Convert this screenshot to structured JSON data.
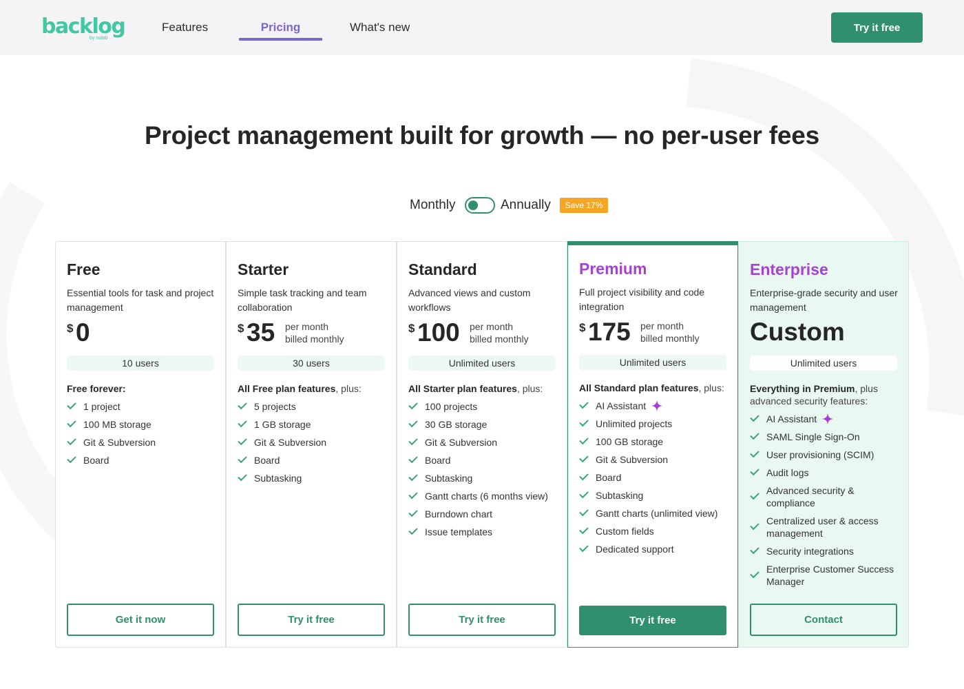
{
  "header": {
    "logo_text": "backlog",
    "logo_sub": "by nulab",
    "nav": [
      {
        "label": "Features"
      },
      {
        "label": "Pricing"
      },
      {
        "label": "What's new"
      }
    ],
    "cta_label": "Try it free"
  },
  "hero": {
    "headline": "Project management built for growth — no per-user fees"
  },
  "billing": {
    "monthly_label": "Monthly",
    "annually_label": "Annually",
    "save_badge": "Save 17%",
    "toggle_state": "monthly"
  },
  "colors": {
    "brand_green": "#2f8f6e",
    "logo_green": "#42c8a0",
    "nav_active": "#7a66cc",
    "premium_purple": "#a542d1",
    "badge_orange": "#f5a623"
  },
  "plans": [
    {
      "name": "Free",
      "description": "Essential tools for task and project management",
      "currency": "$",
      "price": "0",
      "users": "10 users",
      "intro_bold": "Free forever:",
      "intro_rest": "",
      "features": [
        "1 project",
        "100 MB storage",
        "Git & Subversion",
        "Board"
      ],
      "button": "Get it now"
    },
    {
      "name": "Starter",
      "description": "Simple task tracking and team collaboration",
      "currency": "$",
      "price": "35",
      "per_line1": "per month",
      "per_line2": "billed monthly",
      "users": "30 users",
      "intro_bold": "All Free plan features",
      "intro_rest": ", plus:",
      "features": [
        "5 projects",
        "1 GB storage",
        "Git & Subversion",
        "Board",
        "Subtasking"
      ],
      "button": "Try it free"
    },
    {
      "name": "Standard",
      "description": "Advanced views and custom workflows",
      "currency": "$",
      "price": "100",
      "per_line1": "per month",
      "per_line2": "billed monthly",
      "users": "Unlimited users",
      "intro_bold": "All Starter plan features",
      "intro_rest": ", plus:",
      "features": [
        "100 projects",
        "30 GB storage",
        "Git & Subversion",
        "Board",
        "Subtasking",
        "Gantt charts (6 months view)",
        "Burndown chart",
        "Issue templates"
      ],
      "button": "Try it free"
    },
    {
      "name": "Premium",
      "description": "Full project visibility and code integration",
      "currency": "$",
      "price": "175",
      "per_line1": "per month",
      "per_line2": "billed monthly",
      "users": "Unlimited users",
      "intro_bold": "All Standard plan features",
      "intro_rest": ", plus:",
      "features": [
        "AI Assistant",
        "Unlimited projects",
        "100 GB storage",
        "Git & Subversion",
        "Board",
        "Subtasking",
        "Gantt charts (unlimited view)",
        "Custom fields",
        "Dedicated support"
      ],
      "button": "Try it free"
    },
    {
      "name": "Enterprise",
      "description": "Enterprise-grade security and user management",
      "price_text": "Custom",
      "users": "Unlimited users",
      "intro_bold": "Everything in Premium",
      "intro_rest": ", plus advanced security features:",
      "features": [
        "AI Assistant",
        "SAML Single Sign-On",
        "User provisioning (SCIM)",
        "Audit logs",
        "Advanced security & compliance",
        "Centralized user & access management",
        "Security integrations",
        "Enterprise Customer Success Manager"
      ],
      "button": "Contact"
    }
  ]
}
